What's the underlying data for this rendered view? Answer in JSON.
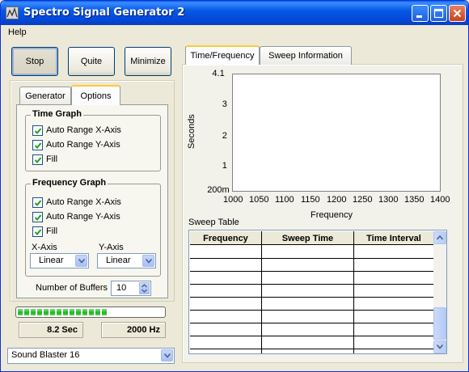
{
  "window": {
    "title": "Spectro Signal Generator 2"
  },
  "menu": {
    "help": "Help"
  },
  "buttons": {
    "stop": "Stop",
    "quite": "Quite",
    "minimize": "Minimize"
  },
  "left_tabs": {
    "generator": "Generator",
    "options": "Options"
  },
  "time_graph": {
    "title": "Time Graph",
    "auto_x": "Auto Range X-Axis",
    "auto_y": "Auto Range Y-Axis",
    "fill": "Fill"
  },
  "frequency_graph": {
    "title": "Frequency Graph",
    "auto_x": "Auto Range X-Axis",
    "auto_y": "Auto Range Y-Axis",
    "fill": "Fill",
    "x_axis_label": "X-Axis",
    "y_axis_label": "Y-Axis",
    "x_axis_value": "Linear",
    "y_axis_value": "Linear"
  },
  "buffers": {
    "label": "Number of Buffers",
    "value": "10"
  },
  "progress": {
    "fraction": 0.63
  },
  "readouts": {
    "time": "8.2 Sec",
    "freq": "2000 Hz"
  },
  "device": {
    "value": "Sound Blaster 16"
  },
  "right_tabs": {
    "time_frequency": "Time/Frequency",
    "sweep_information": "Sweep Information"
  },
  "chart_data": {
    "type": "scatter",
    "title": "",
    "xlabel": "Frequency",
    "ylabel": "Seconds",
    "xlim": [
      1000,
      1400
    ],
    "x_ticks": [
      "1000",
      "1050",
      "1100",
      "1150",
      "1200",
      "1250",
      "1300",
      "1350",
      "1400"
    ],
    "y_ticks": [
      "4.1",
      "3",
      "2",
      "1",
      "200m"
    ],
    "series": []
  },
  "sweep_table": {
    "label": "Sweep Table",
    "columns": [
      "Frequency",
      "Sweep Time",
      "Time Interval"
    ],
    "rows": []
  },
  "colors": {
    "titlebar": "#0659e6",
    "progress": "#22b222"
  }
}
